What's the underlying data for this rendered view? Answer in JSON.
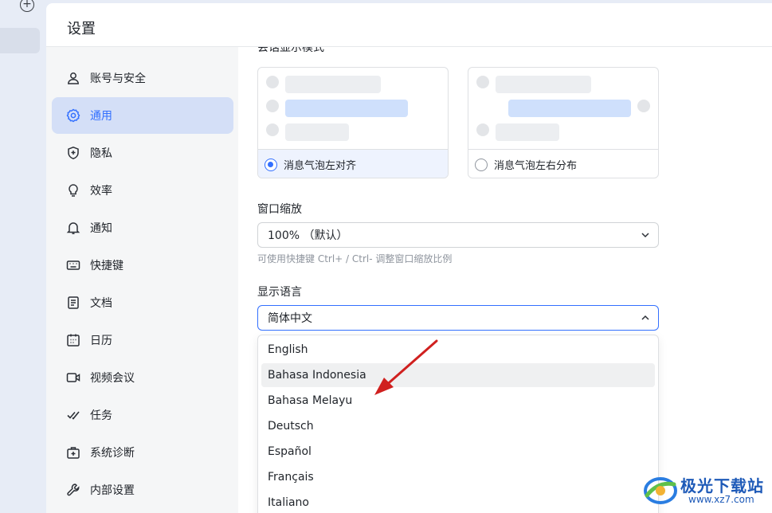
{
  "window": {
    "title": "设置"
  },
  "nav": {
    "items": [
      {
        "label": "账号与安全",
        "icon": "user-icon"
      },
      {
        "label": "通用",
        "icon": "gear-icon",
        "active": true
      },
      {
        "label": "隐私",
        "icon": "shield-icon"
      },
      {
        "label": "效率",
        "icon": "lightbulb-icon"
      },
      {
        "label": "通知",
        "icon": "bell-icon"
      },
      {
        "label": "快捷键",
        "icon": "keyboard-icon"
      },
      {
        "label": "文档",
        "icon": "document-icon"
      },
      {
        "label": "日历",
        "icon": "calendar-icon"
      },
      {
        "label": "视频会议",
        "icon": "video-icon"
      },
      {
        "label": "任务",
        "icon": "task-check-icon"
      },
      {
        "label": "系统诊断",
        "icon": "medical-kit-icon"
      },
      {
        "label": "内部设置",
        "icon": "wrench-icon"
      }
    ]
  },
  "bubble_layout": {
    "options": [
      {
        "label": "消息气泡左对齐",
        "selected": true
      },
      {
        "label": "消息气泡左右分布",
        "selected": false
      }
    ]
  },
  "zoom": {
    "label": "窗口缩放",
    "value": "100% （默认）",
    "hint": "可使用快捷键 Ctrl+ / Ctrl- 调整窗口缩放比例"
  },
  "language": {
    "label": "显示语言",
    "value": "简体中文",
    "options": [
      "English",
      "Bahasa Indonesia",
      "Bahasa Melayu",
      "Deutsch",
      "Español",
      "Français",
      "Italiano"
    ],
    "hovered": "Bahasa Indonesia"
  },
  "watermark": {
    "text": "极光下载站",
    "url": "www.xz7.com"
  },
  "colors": {
    "accent": "#3370ff",
    "active_nav": "#d4dff7",
    "arrow": "#d0201f"
  }
}
